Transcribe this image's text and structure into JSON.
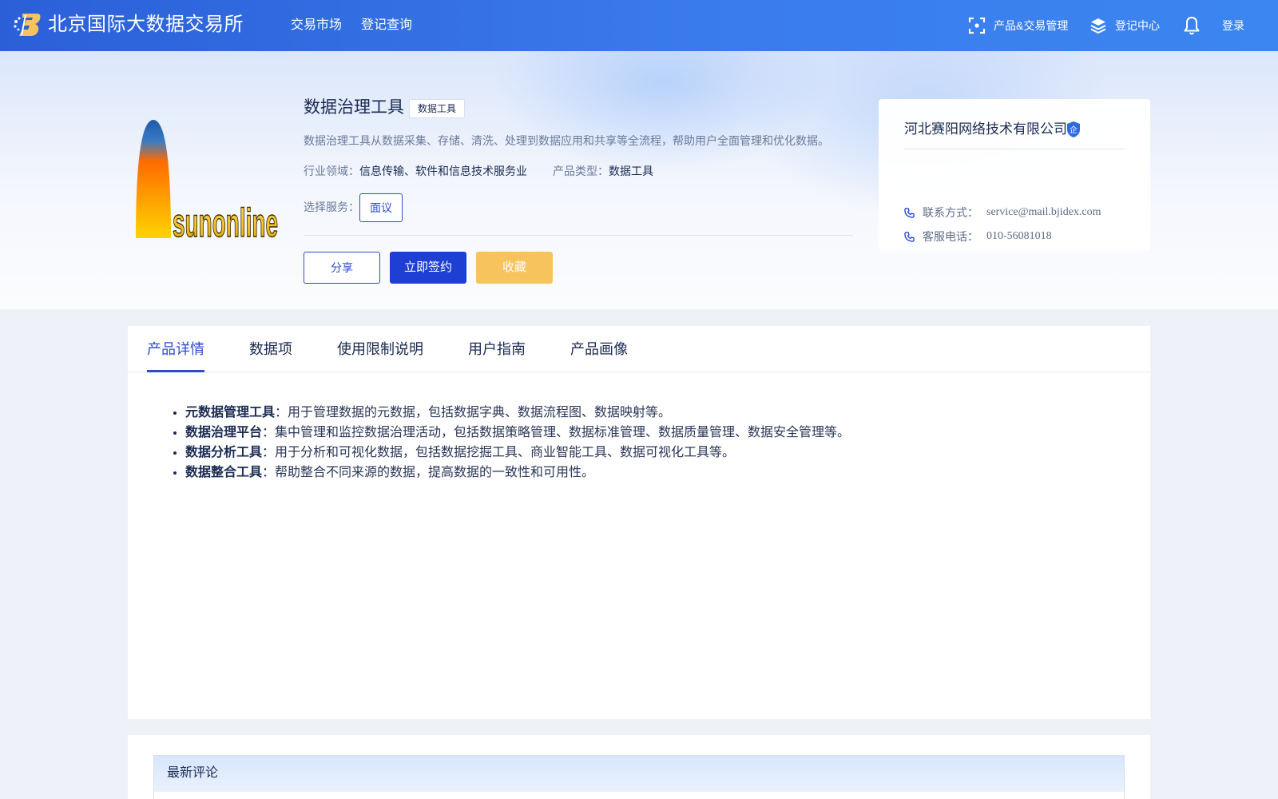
{
  "header": {
    "site_title": "北京国际大数据交易所",
    "logo_icon": "bigdata-exchange-logo-icon",
    "nav": [
      {
        "label": "交易市场"
      },
      {
        "label": "登记查询"
      }
    ],
    "right_items": [
      {
        "label": "产品&交易管理",
        "icon": "scan-icon"
      },
      {
        "label": "登记中心",
        "icon": "layers-icon"
      }
    ],
    "notification_icon": "bell-icon",
    "login_label": "登录"
  },
  "product": {
    "name": "数据治理工具",
    "tag": "数据工具",
    "description": "数据治理工具从数据采集、存储、清洗、处理到数据应用和共享等全流程，帮助用户全面管理和优化数据。",
    "industry_label": "行业领域：",
    "industry_value": "信息传输、软件和信息技术服务业",
    "type_label": "产品类型：",
    "type_value": "数据工具",
    "service_label": "选择服务：",
    "service_option": "面议",
    "logo_text": "sunonline",
    "buttons": {
      "share": "分享",
      "sign": "立即签约",
      "favorite": "收藏"
    }
  },
  "seller": {
    "name": "河北赛阳网络技术有限公司",
    "badge_text": "企",
    "contacts": [
      {
        "label": "联系方式：",
        "value": "service@mail.bjidex.com",
        "icon": "phone-icon"
      },
      {
        "label": "客服电话：",
        "value": "010-56081018",
        "icon": "phone-icon"
      }
    ]
  },
  "tabs": [
    {
      "label": "产品详情",
      "active": true
    },
    {
      "label": "数据项",
      "active": false
    },
    {
      "label": "使用限制说明",
      "active": false
    },
    {
      "label": "用户指南",
      "active": false
    },
    {
      "label": "产品画像",
      "active": false
    }
  ],
  "details": [
    {
      "term": "元数据管理工具",
      "text": "：用于管理数据的元数据，包括数据字典、数据流程图、数据映射等。"
    },
    {
      "term": "数据治理平台",
      "text": "：集中管理和监控数据治理活动，包括数据策略管理、数据标准管理、数据质量管理、数据安全管理等。"
    },
    {
      "term": "数据分析工具",
      "text": "：用于分析和可视化数据，包括数据挖掘工具、商业智能工具、数据可视化工具等。"
    },
    {
      "term": "数据整合工具",
      "text": "：帮助整合不同来源的数据，提高数据的一致性和可用性。"
    }
  ],
  "comments": {
    "title": "最新评论"
  },
  "colors": {
    "brand_blue": "#1f3fd4",
    "accent_yellow": "#f6c35c",
    "header_gradient_start": "#2b5fd8",
    "header_gradient_end": "#3b86f0"
  }
}
